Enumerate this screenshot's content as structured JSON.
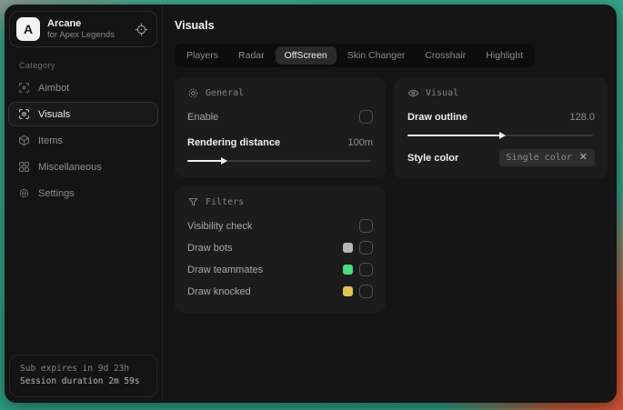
{
  "app": {
    "logo_letter": "A",
    "name": "Arcane",
    "subtitle": "for Apex Legends"
  },
  "sidebar": {
    "category_label": "Category",
    "items": [
      {
        "label": "Aimbot",
        "icon": "aimbot-icon",
        "selected": false
      },
      {
        "label": "Visuals",
        "icon": "visuals-icon",
        "selected": true
      },
      {
        "label": "Items",
        "icon": "items-icon",
        "selected": false
      },
      {
        "label": "Miscellaneous",
        "icon": "miscellaneous-icon",
        "selected": false
      },
      {
        "label": "Settings",
        "icon": "settings-icon",
        "selected": false
      }
    ],
    "footer": {
      "line1": "Sub expires in 9d 23h",
      "line2": "Session duration 2m 59s"
    }
  },
  "header": {
    "title": "Visuals"
  },
  "tabs": [
    {
      "label": "Players",
      "selected": false
    },
    {
      "label": "Radar",
      "selected": false
    },
    {
      "label": "OffScreen",
      "selected": true
    },
    {
      "label": "Skin Changer",
      "selected": false
    },
    {
      "label": "Crosshair",
      "selected": false
    },
    {
      "label": "Highlight",
      "selected": false
    }
  ],
  "panels": {
    "general": {
      "title": "General",
      "icon": "sun-icon",
      "enable_label": "Enable",
      "enable_checked": false,
      "rendering_label": "Rendering distance",
      "rendering_value": "100m",
      "rendering_percent": 20
    },
    "visual": {
      "title": "Visual",
      "icon": "eye-icon",
      "outline_label": "Draw outline",
      "outline_value": "128.0",
      "outline_percent": 51,
      "style_label": "Style color",
      "style_value": "Single color",
      "style_clear_icon": "close-icon"
    },
    "filters": {
      "title": "Filters",
      "icon": "funnel-icon",
      "rows": [
        {
          "label": "Visibility check",
          "swatch": null,
          "checked": false
        },
        {
          "label": "Draw bots",
          "swatch": "#b8b8b8",
          "checked": false
        },
        {
          "label": "Draw teammates",
          "swatch": "#4ade80",
          "checked": false
        },
        {
          "label": "Draw knocked",
          "swatch": "#e5c452",
          "checked": false
        }
      ]
    }
  }
}
